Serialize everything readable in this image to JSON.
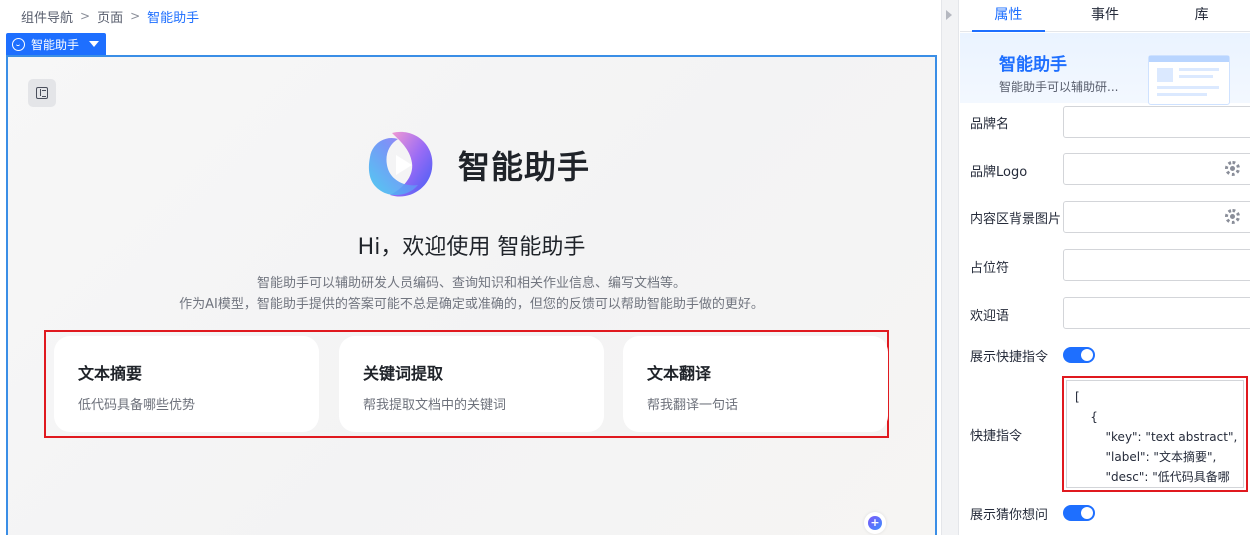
{
  "breadcrumb": [
    "组件导航",
    "页面",
    "智能助手"
  ],
  "component_tag": "智能助手",
  "brand": {
    "name": "智能助手"
  },
  "welcome": "Hi，欢迎使用 智能助手",
  "description": [
    "智能助手可以辅助研发人员编码、查询知识和相关作业信息、编写文档等。",
    "作为AI模型，智能助手提供的答案可能不总是确定或准确的，但您的反馈可以帮助智能助手做的更好。"
  ],
  "commands": [
    {
      "title": "文本摘要",
      "desc": "低代码具备哪些优势"
    },
    {
      "title": "关键词提取",
      "desc": "帮我提取文档中的关键词"
    },
    {
      "title": "文本翻译",
      "desc": "帮我翻译一句话"
    }
  ],
  "panel": {
    "tabs": [
      "属性",
      "事件",
      "库"
    ],
    "header_title": "智能助手",
    "header_sub": "智能助手可以辅助研...",
    "fields": {
      "brand_name": "品牌名",
      "brand_logo": "品牌Logo",
      "bg_image": "内容区背景图片",
      "placeholder": "占位符",
      "welcome": "欢迎语",
      "show_quick": "展示快捷指令",
      "quick": "快捷指令",
      "show_guess": "展示猜你想问"
    },
    "quick_code": "[\n    {\n        \"key\": \"text abstract\",\n        \"label\": \"文本摘要\",\n        \"desc\": \"低代码具备哪"
  },
  "colors": {
    "accent": "#1e6fff",
    "highlight": "#e0191f"
  }
}
